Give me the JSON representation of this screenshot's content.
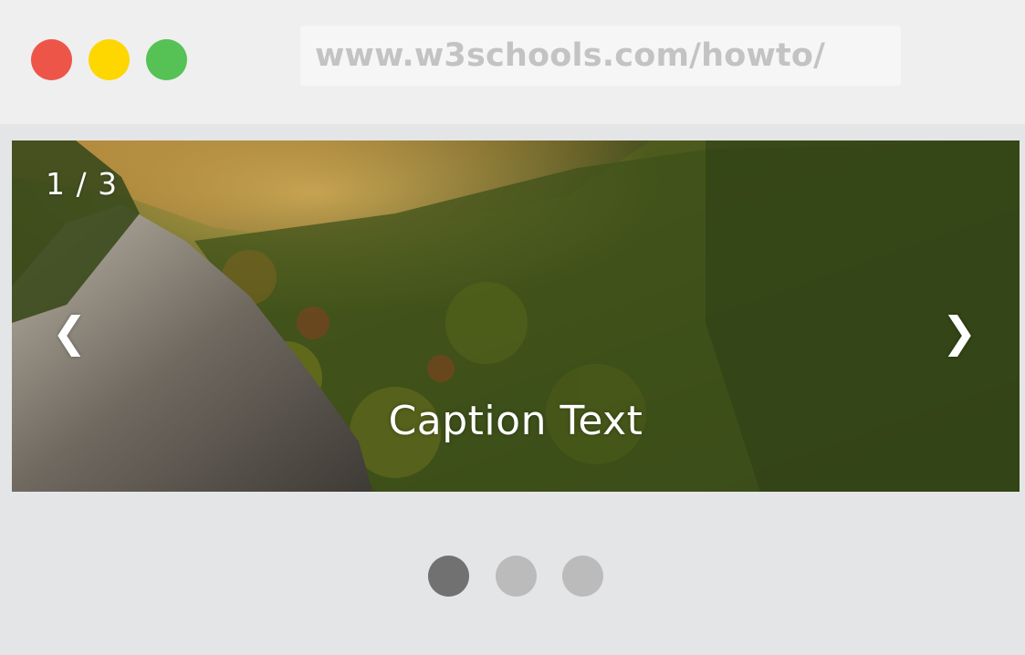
{
  "window": {
    "controls": [
      {
        "name": "close",
        "color": "#ee5549"
      },
      {
        "name": "minimize",
        "color": "#fed600"
      },
      {
        "name": "maximize",
        "color": "#56c155"
      }
    ],
    "address": "www.w3schools.com/howto/"
  },
  "slideshow": {
    "counter": "1 / 3",
    "prev_label": "❮",
    "next_label": "❯",
    "caption": "Caption Text",
    "image": "mountain-forest-landscape"
  },
  "indicators": {
    "active_index": 0,
    "items": [
      {
        "color": "#717171"
      },
      {
        "color": "#bbbbbb"
      },
      {
        "color": "#bbbbbb"
      }
    ]
  }
}
